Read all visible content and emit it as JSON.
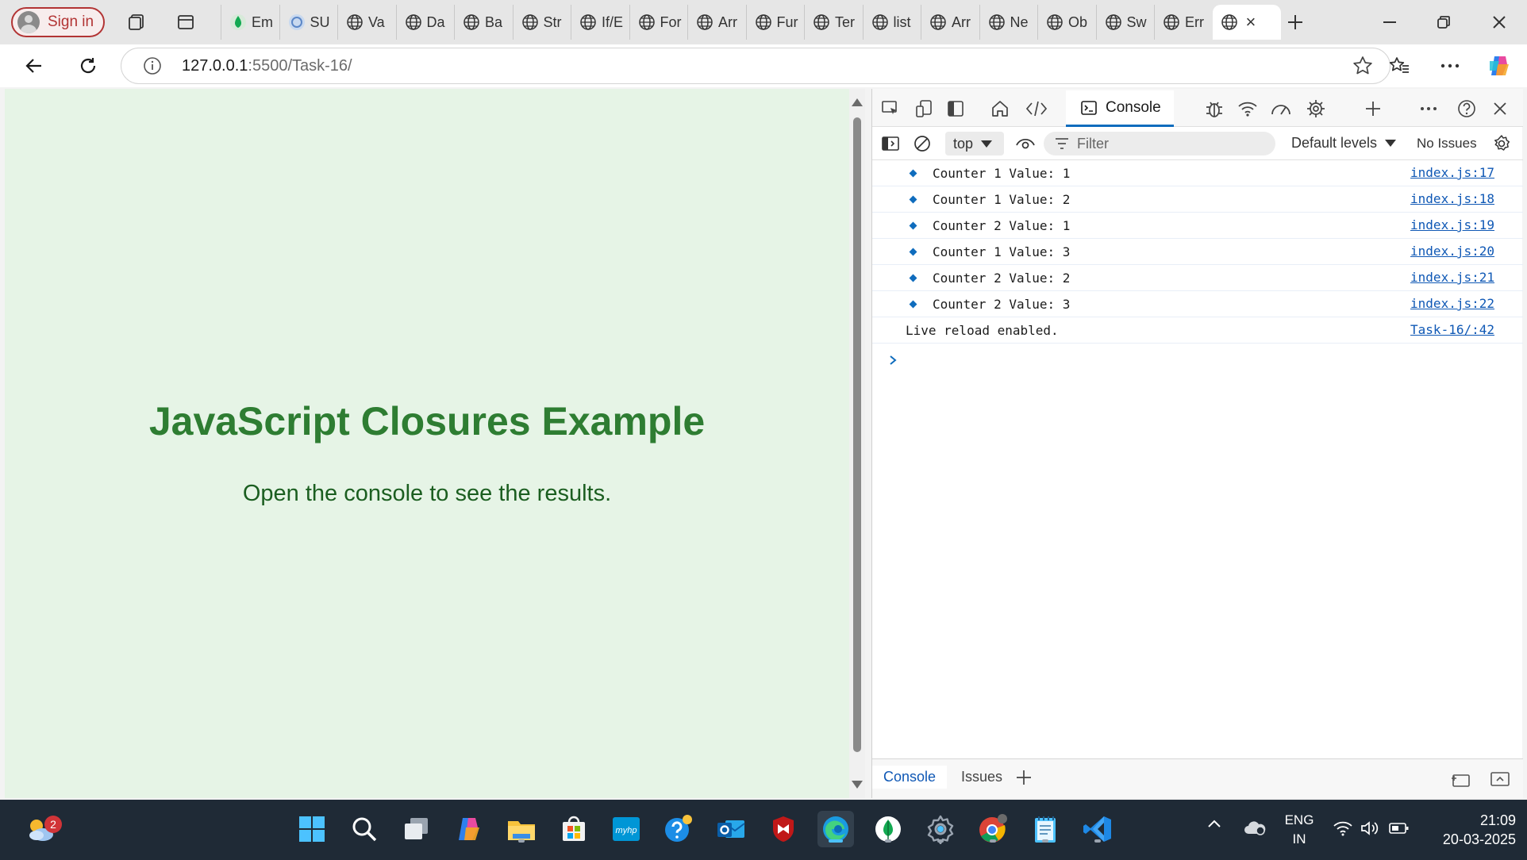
{
  "browser": {
    "sign_in_label": "Sign in",
    "tabs": [
      {
        "label": "Em",
        "icon": "mongodb-leaf-icon"
      },
      {
        "label": "SU",
        "icon": "circle-site-icon"
      },
      {
        "label": "Va",
        "icon": "globe-icon"
      },
      {
        "label": "Da",
        "icon": "globe-icon"
      },
      {
        "label": "Ba",
        "icon": "globe-icon"
      },
      {
        "label": "Str",
        "icon": "globe-icon"
      },
      {
        "label": "If/E",
        "icon": "globe-icon"
      },
      {
        "label": "For",
        "icon": "globe-icon"
      },
      {
        "label": "Arr",
        "icon": "globe-icon"
      },
      {
        "label": "Fur",
        "icon": "globe-icon"
      },
      {
        "label": "Ter",
        "icon": "globe-icon"
      },
      {
        "label": "list",
        "icon": "globe-icon"
      },
      {
        "label": "Arr",
        "icon": "globe-icon"
      },
      {
        "label": "Ne",
        "icon": "globe-icon"
      },
      {
        "label": "Ob",
        "icon": "globe-icon"
      },
      {
        "label": "Sw",
        "icon": "globe-icon"
      },
      {
        "label": "Err",
        "icon": "globe-icon"
      }
    ],
    "url_host": "127.0.0.1",
    "url_rest": ":5500/Task-16/"
  },
  "page": {
    "title": "JavaScript Closures Example",
    "subtitle": "Open the console to see the results."
  },
  "devtools": {
    "active_tab": "Console",
    "context": "top",
    "filter_placeholder": "Filter",
    "levels_label": "Default levels",
    "issues_label": "No Issues",
    "messages": [
      {
        "text": "Counter 1 Value: 1",
        "source": "index.js:17",
        "kind": "info"
      },
      {
        "text": "Counter 1 Value: 2",
        "source": "index.js:18",
        "kind": "info"
      },
      {
        "text": "Counter 2 Value: 1",
        "source": "index.js:19",
        "kind": "info"
      },
      {
        "text": "Counter 1 Value: 3",
        "source": "index.js:20",
        "kind": "info"
      },
      {
        "text": "Counter 2 Value: 2",
        "source": "index.js:21",
        "kind": "info"
      },
      {
        "text": "Counter 2 Value: 3",
        "source": "index.js:22",
        "kind": "info"
      },
      {
        "text": "Live reload enabled.",
        "source": "Task-16/:42",
        "kind": "plain"
      }
    ],
    "drawer_tabs": [
      "Console",
      "Issues"
    ]
  },
  "taskbar": {
    "weather_badge": "2",
    "lang_line1": "ENG",
    "lang_line2": "IN",
    "time": "21:09",
    "date": "20-03-2025"
  },
  "colors": {
    "page_bg": "#e6f4e6",
    "heading": "#2e7d32",
    "accent": "#0f6cbd"
  }
}
